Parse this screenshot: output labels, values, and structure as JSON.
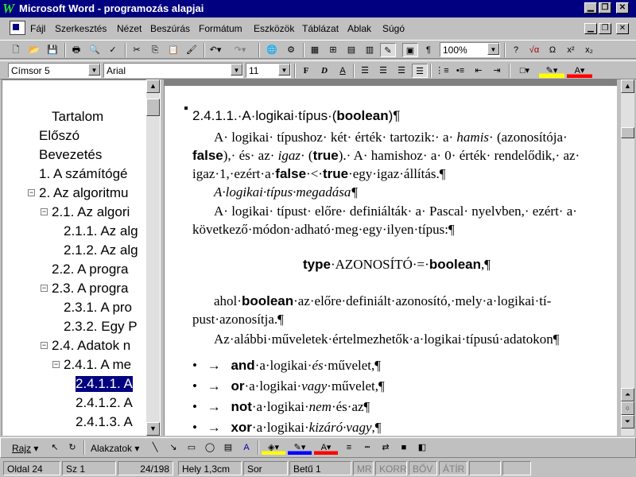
{
  "window": {
    "title": "Microsoft Word - programozás alapjai"
  },
  "menu": [
    "Fájl",
    "Szerkesztés",
    "Nézet",
    "Beszúrás",
    "Formátum",
    "Eszközök",
    "Táblázat",
    "Ablak",
    "Súgó"
  ],
  "format_bar": {
    "style": "Címsor 5",
    "font": "Arial",
    "size": "11",
    "zoom": "100%"
  },
  "docmap": {
    "items": [
      {
        "label": "Tartalom",
        "level": 1,
        "expand": ""
      },
      {
        "label": "Előszó",
        "level": 0,
        "expand": ""
      },
      {
        "label": "Bevezetés",
        "level": 0,
        "expand": ""
      },
      {
        "label": "1. A számítógé",
        "level": 0,
        "expand": ""
      },
      {
        "label": "2. Az algoritmu",
        "level": 0,
        "expand": "−"
      },
      {
        "label": "2.1. Az algori",
        "level": 1,
        "expand": "−"
      },
      {
        "label": "2.1.1. Az alg",
        "level": 2,
        "expand": ""
      },
      {
        "label": "2.1.2. Az alg",
        "level": 2,
        "expand": ""
      },
      {
        "label": "2.2. A progra",
        "level": 1,
        "expand": ""
      },
      {
        "label": "2.3. A progra",
        "level": 1,
        "expand": "−"
      },
      {
        "label": "2.3.1. A pro",
        "level": 2,
        "expand": ""
      },
      {
        "label": "2.3.2. Egy P",
        "level": 2,
        "expand": ""
      },
      {
        "label": "2.4. Adatok n",
        "level": 1,
        "expand": "−"
      },
      {
        "label": "2.4.1. A me",
        "level": 2,
        "expand": "−"
      },
      {
        "label": "2.4.1.1. A",
        "level": 3,
        "expand": "",
        "selected": true
      },
      {
        "label": "2.4.1.2. A",
        "level": 3,
        "expand": ""
      },
      {
        "label": "2.4.1.3. A",
        "level": 3,
        "expand": ""
      }
    ]
  },
  "doc": {
    "heading": "2.4.1.1.·A·logikai·típus·(boolean)¶",
    "p1_line1": "A· logikai· típushoz· két· érték· tartozik:· a· hamis· (azonosítója·",
    "p1_line2": "false),· és· az· igaz· (true).· A· hamishoz· a· 0· érték· rendelődik,· az·",
    "p1_line3": "igaz·1,·ezért·a·false·<·true·egy·igaz·állítás.¶",
    "p2": "A·logikai·típus·megadása¶",
    "p3_line1": "A· logikai· típust· előre· definiálták· a· Pascal· nyelvben,· ezért· a·",
    "p3_line2": "következő·módon·adható·meg·egy·ilyen·típus:¶",
    "code": "type·AZONOSÍTÓ·=·boolean,¶",
    "p4_line1": "ahol·boolean·az·előre·definiált·azonosító,·mely·a·logikai·tí-",
    "p4_line2": "pust·azonosítja.¶",
    "p5": "Az·alábbi·műveletek·értelmezhetők·a·logikai·típusú·adatokon¶",
    "bullets": [
      {
        "kw": "and",
        "text": "·a·logikai·",
        "it": "és",
        "rest": "·művelet,¶"
      },
      {
        "kw": "or",
        "text": "·a·logikai·",
        "it": "vagy",
        "rest": "·művelet,¶"
      },
      {
        "kw": "not",
        "text": "·a·logikai·",
        "it": "nem",
        "rest": "·és·az¶"
      },
      {
        "kw": "xor",
        "text": "·a·logikai·",
        "it": "kizáró·vagy",
        "rest": ",¶"
      }
    ]
  },
  "drawbar": {
    "draw": "Rajz",
    "shapes": "Alakzatok"
  },
  "status": {
    "page": "Oldal 24",
    "section": "Sz 1",
    "pages": "24/198",
    "pos": "Hely 1,3cm",
    "line": "Sor",
    "col": "Betű 1",
    "rec": "MR",
    "trk": "KORR",
    "ext": "BŐV",
    "ovr": "ÁTÍR"
  }
}
